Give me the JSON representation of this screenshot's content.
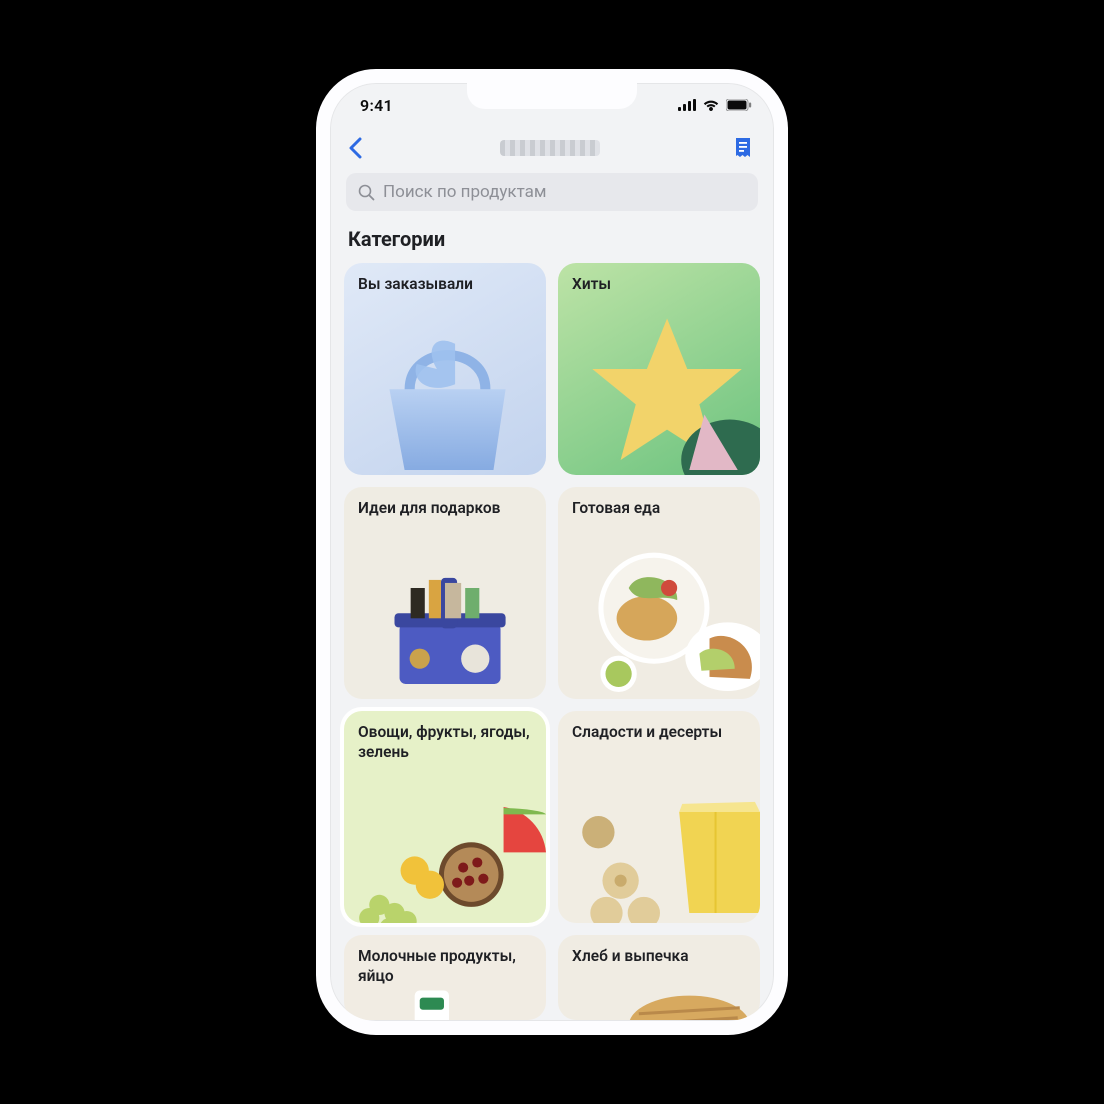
{
  "status": {
    "time": "9:41"
  },
  "search": {
    "placeholder": "Поиск по продуктам"
  },
  "section_title": "Категории",
  "colors": {
    "accent": "#2d6ae3"
  },
  "categories": [
    {
      "id": "ordered",
      "label": "Вы заказывали"
    },
    {
      "id": "hits",
      "label": "Хиты"
    },
    {
      "id": "gifts",
      "label": "Идеи для подарков"
    },
    {
      "id": "ready",
      "label": "Готовая еда"
    },
    {
      "id": "produce",
      "label": "Овощи, фрукты, ягоды, зелень"
    },
    {
      "id": "sweets",
      "label": "Сладости и десерты"
    },
    {
      "id": "dairy",
      "label": "Молочные продукты, яйцо"
    },
    {
      "id": "bread",
      "label": "Хлеб и выпечка"
    }
  ]
}
